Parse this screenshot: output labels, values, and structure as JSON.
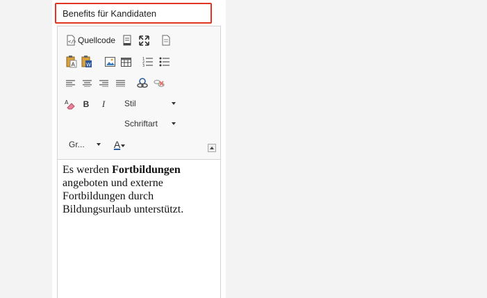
{
  "title_field": {
    "value": "Benefits für Kandidaten"
  },
  "toolbar": {
    "source_label": "Quellcode",
    "bold_label": "B",
    "italic_label": "I",
    "style_combo": "Stil",
    "font_combo": "Schriftart",
    "size_combo": "Gr...",
    "text_color_label": "A"
  },
  "content": {
    "text_before": "Es werden ",
    "bold_word": "Fortbildungen",
    "text_after": " angeboten und externe Fortbildungen durch Bildungsurlaub unterstützt."
  }
}
